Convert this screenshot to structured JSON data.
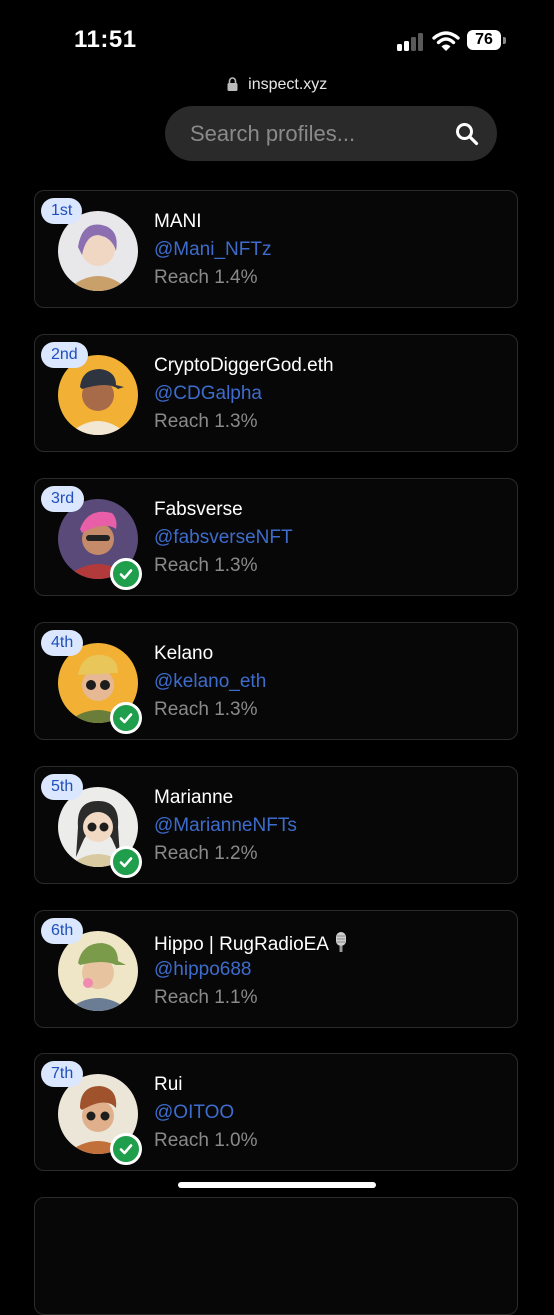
{
  "status": {
    "time": "11:51",
    "battery": "76"
  },
  "browser": {
    "url": "inspect.xyz"
  },
  "search": {
    "placeholder": "Search profiles..."
  },
  "profiles": [
    {
      "rank": "1st",
      "name": "MANI",
      "handle": "@Mani_NFTz",
      "reach": "Reach 1.4%",
      "verified": false,
      "avatar_colors": {
        "bg": "#e8e8ea",
        "hair": "#8b6fb0",
        "skin": "#f0d7c3",
        "shirt": "#c9a06a"
      }
    },
    {
      "rank": "2nd",
      "name": "CryptoDiggerGod.eth",
      "handle": "@CDGalpha",
      "reach": "Reach 1.3%",
      "verified": false,
      "avatar_colors": {
        "bg": "#f2b134",
        "hair": "#2e3440",
        "skin": "#a86b4a",
        "shirt": "#f1e7d3"
      }
    },
    {
      "rank": "3rd",
      "name": "Fabsverse",
      "handle": "@fabsverseNFT",
      "reach": "Reach 1.3%",
      "verified": true,
      "avatar_colors": {
        "bg": "#5a4a7a",
        "hair": "#e85fa8",
        "skin": "#c48a6a",
        "shirt": "#b33a3a"
      }
    },
    {
      "rank": "4th",
      "name": "Kelano",
      "handle": "@kelano_eth",
      "reach": "Reach 1.3%",
      "verified": true,
      "avatar_colors": {
        "bg": "#f2b134",
        "hair": "#e8c65a",
        "skin": "#e6b894",
        "shirt": "#6b7d3a"
      }
    },
    {
      "rank": "5th",
      "name": "Marianne",
      "handle": "@MarianneNFTs",
      "reach": "Reach 1.2%",
      "verified": true,
      "avatar_colors": {
        "bg": "#ececea",
        "hair": "#2b2b2b",
        "skin": "#f1d9c4",
        "shirt": "#d8c9a0"
      }
    },
    {
      "rank": "6th",
      "name": "Hippo | RugRadioEA",
      "handle": "@hippo688",
      "reach": "Reach 1.1%",
      "verified": false,
      "avatar_colors": {
        "bg": "#efe6c8",
        "hair": "#7a9b4a",
        "skin": "#e8c3a0",
        "shirt": "#6a7d94"
      }
    },
    {
      "rank": "7th",
      "name": "Rui",
      "handle": "@OITOO",
      "reach": "Reach 1.0%",
      "verified": true,
      "avatar_colors": {
        "bg": "#ece6d8",
        "hair": "#a0522d",
        "skin": "#e0b08c",
        "shirt": "#c2703a"
      }
    }
  ]
}
